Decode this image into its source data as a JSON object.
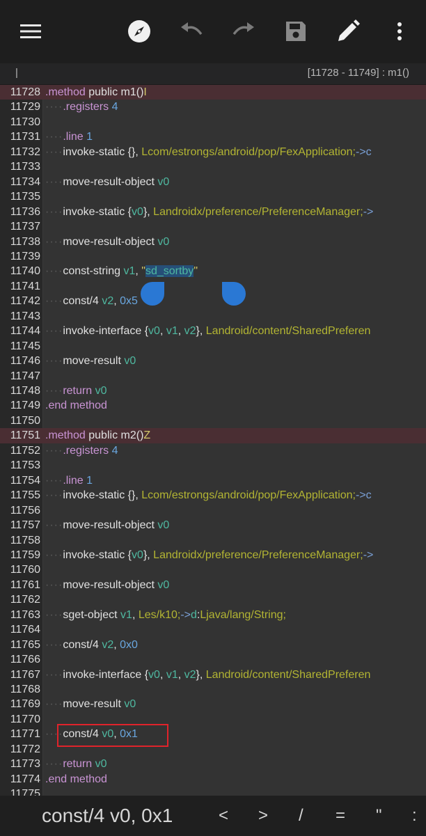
{
  "toolbar": {
    "icons": [
      "menu-icon",
      "compass-icon",
      "undo-icon",
      "redo-icon",
      "save-icon",
      "edit-icon",
      "more-vert-icon"
    ]
  },
  "info_bar": {
    "cursor_mark": "|",
    "range": "[11728 - 11749] : m1()"
  },
  "editor": {
    "selected_text": "sd_sortby",
    "lines": [
      {
        "n": "11728",
        "hl": true,
        "tokens": [
          [
            "kw",
            ".method"
          ],
          [
            "op",
            " public m1()"
          ],
          [
            "str",
            "I"
          ]
        ]
      },
      {
        "n": "11729",
        "dots": true,
        "tokens": [
          [
            "kw",
            ".registers"
          ],
          [
            "op",
            " "
          ],
          [
            "num",
            "4"
          ]
        ]
      },
      {
        "n": "11730",
        "tokens": []
      },
      {
        "n": "11731",
        "dots": true,
        "tokens": [
          [
            "kw",
            ".line"
          ],
          [
            "op",
            " "
          ],
          [
            "num",
            "1"
          ]
        ]
      },
      {
        "n": "11732",
        "dots": true,
        "tokens": [
          [
            "op",
            "invoke-static {}, "
          ],
          [
            "cls",
            "Lcom/estrongs/android/pop/FexApplication;"
          ],
          [
            "arrow",
            "->c"
          ]
        ]
      },
      {
        "n": "11733",
        "tokens": []
      },
      {
        "n": "11734",
        "dots": true,
        "tokens": [
          [
            "op",
            "move-result-object "
          ],
          [
            "reg",
            "v0"
          ]
        ]
      },
      {
        "n": "11735",
        "tokens": []
      },
      {
        "n": "11736",
        "dots": true,
        "tokens": [
          [
            "op",
            "invoke-static {"
          ],
          [
            "reg",
            "v0"
          ],
          [
            "op",
            "}, "
          ],
          [
            "cls",
            "Landroidx/preference/PreferenceManager;"
          ],
          [
            "arrow",
            "->"
          ]
        ]
      },
      {
        "n": "11737",
        "tokens": []
      },
      {
        "n": "11738",
        "dots": true,
        "tokens": [
          [
            "op",
            "move-result-object "
          ],
          [
            "reg",
            "v0"
          ]
        ]
      },
      {
        "n": "11739",
        "tokens": []
      },
      {
        "n": "11740",
        "dots": true,
        "tokens": [
          [
            "op",
            "const-string "
          ],
          [
            "reg",
            "v1"
          ],
          [
            "op",
            ", "
          ],
          [
            "str",
            "\""
          ],
          [
            "sel",
            "sd_sortby"
          ],
          [
            "str",
            "\""
          ]
        ]
      },
      {
        "n": "11741",
        "tokens": []
      },
      {
        "n": "11742",
        "dots": true,
        "tokens": [
          [
            "op",
            "const/4 "
          ],
          [
            "reg",
            "v2"
          ],
          [
            "op",
            ", "
          ],
          [
            "num",
            "0x5"
          ]
        ]
      },
      {
        "n": "11743",
        "tokens": []
      },
      {
        "n": "11744",
        "dots": true,
        "tokens": [
          [
            "op",
            "invoke-interface {"
          ],
          [
            "reg",
            "v0"
          ],
          [
            "op",
            ", "
          ],
          [
            "reg",
            "v1"
          ],
          [
            "op",
            ", "
          ],
          [
            "reg",
            "v2"
          ],
          [
            "op",
            "}, "
          ],
          [
            "cls",
            "Landroid/content/SharedPreferen"
          ]
        ]
      },
      {
        "n": "11745",
        "tokens": []
      },
      {
        "n": "11746",
        "dots": true,
        "tokens": [
          [
            "op",
            "move-result "
          ],
          [
            "reg",
            "v0"
          ]
        ]
      },
      {
        "n": "11747",
        "tokens": []
      },
      {
        "n": "11748",
        "dots": true,
        "tokens": [
          [
            "kw",
            "return"
          ],
          [
            "op",
            " "
          ],
          [
            "reg",
            "v0"
          ]
        ]
      },
      {
        "n": "11749",
        "tokens": [
          [
            "kw",
            ".end method"
          ]
        ]
      },
      {
        "n": "11750",
        "tokens": []
      },
      {
        "n": "11751",
        "hl": true,
        "tokens": [
          [
            "kw",
            ".method"
          ],
          [
            "op",
            " public m2()"
          ],
          [
            "str",
            "Z"
          ]
        ]
      },
      {
        "n": "11752",
        "dots": true,
        "tokens": [
          [
            "kw",
            ".registers"
          ],
          [
            "op",
            " "
          ],
          [
            "num",
            "4"
          ]
        ]
      },
      {
        "n": "11753",
        "tokens": []
      },
      {
        "n": "11754",
        "dots": true,
        "tokens": [
          [
            "kw",
            ".line"
          ],
          [
            "op",
            " "
          ],
          [
            "num",
            "1"
          ]
        ]
      },
      {
        "n": "11755",
        "dots": true,
        "tokens": [
          [
            "op",
            "invoke-static {}, "
          ],
          [
            "cls",
            "Lcom/estrongs/android/pop/FexApplication;"
          ],
          [
            "arrow",
            "->c"
          ]
        ]
      },
      {
        "n": "11756",
        "tokens": []
      },
      {
        "n": "11757",
        "dots": true,
        "tokens": [
          [
            "op",
            "move-result-object "
          ],
          [
            "reg",
            "v0"
          ]
        ]
      },
      {
        "n": "11758",
        "tokens": []
      },
      {
        "n": "11759",
        "dots": true,
        "tokens": [
          [
            "op",
            "invoke-static {"
          ],
          [
            "reg",
            "v0"
          ],
          [
            "op",
            "}, "
          ],
          [
            "cls",
            "Landroidx/preference/PreferenceManager;"
          ],
          [
            "arrow",
            "->"
          ]
        ]
      },
      {
        "n": "11760",
        "tokens": []
      },
      {
        "n": "11761",
        "dots": true,
        "tokens": [
          [
            "op",
            "move-result-object "
          ],
          [
            "reg",
            "v0"
          ]
        ]
      },
      {
        "n": "11762",
        "tokens": []
      },
      {
        "n": "11763",
        "dots": true,
        "tokens": [
          [
            "op",
            "sget-object "
          ],
          [
            "reg",
            "v1"
          ],
          [
            "op",
            ", "
          ],
          [
            "cls",
            "Les/k10;"
          ],
          [
            "arrow",
            "->"
          ],
          [
            "field",
            "d"
          ],
          [
            "op",
            ":"
          ],
          [
            "cls",
            "Ljava/lang/String;"
          ]
        ]
      },
      {
        "n": "11764",
        "tokens": []
      },
      {
        "n": "11765",
        "dots": true,
        "tokens": [
          [
            "op",
            "const/4 "
          ],
          [
            "reg",
            "v2"
          ],
          [
            "op",
            ", "
          ],
          [
            "num",
            "0x0"
          ]
        ]
      },
      {
        "n": "11766",
        "tokens": []
      },
      {
        "n": "11767",
        "dots": true,
        "tokens": [
          [
            "op",
            "invoke-interface {"
          ],
          [
            "reg",
            "v0"
          ],
          [
            "op",
            ", "
          ],
          [
            "reg",
            "v1"
          ],
          [
            "op",
            ", "
          ],
          [
            "reg",
            "v2"
          ],
          [
            "op",
            "}, "
          ],
          [
            "cls",
            "Landroid/content/SharedPreferen"
          ]
        ]
      },
      {
        "n": "11768",
        "tokens": []
      },
      {
        "n": "11769",
        "dots": true,
        "tokens": [
          [
            "op",
            "move-result "
          ],
          [
            "reg",
            "v0"
          ]
        ]
      },
      {
        "n": "11770",
        "tokens": []
      },
      {
        "n": "11771",
        "dots": true,
        "tokens": [
          [
            "op",
            "const/4 "
          ],
          [
            "reg",
            "v0"
          ],
          [
            "op",
            ", "
          ],
          [
            "num",
            "0x1"
          ]
        ]
      },
      {
        "n": "11772",
        "tokens": []
      },
      {
        "n": "11773",
        "dots": true,
        "tokens": [
          [
            "kw",
            "return"
          ],
          [
            "op",
            " "
          ],
          [
            "reg",
            "v0"
          ]
        ]
      },
      {
        "n": "11774",
        "tokens": [
          [
            "kw",
            ".end method"
          ]
        ]
      },
      {
        "n": "11775",
        "tokens": []
      }
    ]
  },
  "bottom_bar": {
    "preview": "const/4 v0, 0x1",
    "symbols": [
      "<",
      ">",
      "/",
      "=",
      "\"",
      ":"
    ]
  },
  "colors": {
    "background": "#252526",
    "editor_bg": "#333333",
    "method_highlight": "#4a2e33",
    "selection": "#264f78",
    "annotation_box": "#e0232b",
    "handle": "#2a78d4"
  }
}
